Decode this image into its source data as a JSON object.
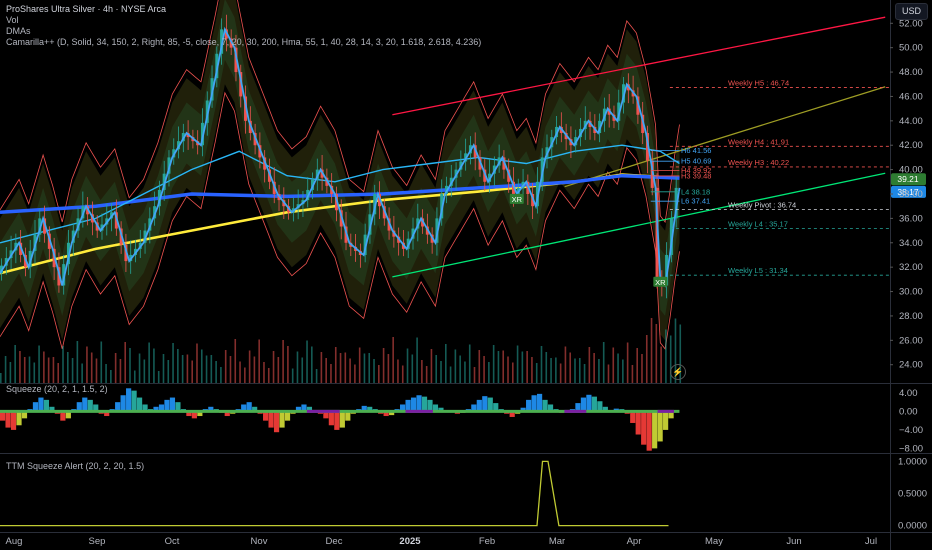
{
  "header": {
    "symbol_title": "ProShares Ultra Silver · 4h · NYSE Arca",
    "ind_vol": "Vol",
    "ind_dmas": "DMAs",
    "ind_camarilla": "Camarilla++ (D, Solid, 34, 150, 2, Right, 85, -5, close, 7, 20, 30, 200, Hma, 55, 1, 40, 28, 14, 3, 20, 1.618, 2.618, 4.236)",
    "currency_button": "USD"
  },
  "panes": {
    "squeeze_title": "Squeeze (20, 2, 1, 1.5, 2)",
    "ttm_title": "TTM Squeeze Alert (20, 2, 20, 1.5)"
  },
  "colors": {
    "background": "#000000",
    "candle_up": "#26a69a",
    "candle_down": "#ef5350",
    "dma_blue": "#2962ff",
    "dma_yellow": "#ffeb3b",
    "channel_red": "#ff1744",
    "channel_green": "#00e676",
    "hma_cyan": "#29b6f6"
  },
  "chart_data": [
    {
      "type": "line",
      "name": "price",
      "x_axis_labels": [
        "Aug",
        "Sep",
        "Oct",
        "Nov",
        "Dec",
        "2025",
        "Feb",
        "Mar",
        "Apr",
        "May",
        "Jun",
        "Jul"
      ],
      "y_ticks": [
        "52.00",
        "50.00",
        "48.00",
        "46.00",
        "44.00",
        "42.00",
        "40.00",
        "38.00",
        "36.00",
        "34.00",
        "32.00",
        "30.00",
        "28.00",
        "26.00",
        "24.00"
      ],
      "ylim": [
        22.5,
        53.5
      ],
      "price_path": [
        [
          0,
          31.5
        ],
        [
          4,
          34
        ],
        [
          6,
          32
        ],
        [
          9,
          36
        ],
        [
          11,
          33.5
        ],
        [
          13,
          30.5
        ],
        [
          15,
          34
        ],
        [
          18,
          37
        ],
        [
          21,
          35
        ],
        [
          24,
          36.5
        ],
        [
          27,
          32.5
        ],
        [
          30,
          34
        ],
        [
          33,
          37
        ],
        [
          36,
          41
        ],
        [
          39,
          43
        ],
        [
          42,
          42
        ],
        [
          45,
          47.5
        ],
        [
          47,
          51.5
        ],
        [
          49,
          50
        ],
        [
          52,
          44
        ],
        [
          55,
          41
        ],
        [
          58,
          38
        ],
        [
          61,
          36.5
        ],
        [
          64,
          37.5
        ],
        [
          67,
          40
        ],
        [
          70,
          38
        ],
        [
          73,
          34
        ],
        [
          76,
          33
        ],
        [
          79,
          38
        ],
        [
          82,
          35
        ],
        [
          85,
          33.5
        ],
        [
          88,
          36
        ],
        [
          91,
          34
        ],
        [
          93,
          38
        ],
        [
          96,
          40
        ],
        [
          99,
          42
        ],
        [
          102,
          39
        ],
        [
          105,
          41
        ],
        [
          108,
          38
        ],
        [
          110,
          39
        ],
        [
          112,
          37
        ],
        [
          114,
          41
        ],
        [
          117,
          43.5
        ],
        [
          120,
          42
        ],
        [
          123,
          44
        ],
        [
          125,
          43
        ],
        [
          127,
          45
        ],
        [
          129,
          44
        ],
        [
          131,
          47
        ],
        [
          133,
          46
        ],
        [
          135,
          43
        ],
        [
          137,
          38.5
        ],
        [
          138,
          31
        ],
        [
          139,
          30.5
        ],
        [
          140,
          33
        ],
        [
          141,
          36
        ],
        [
          142,
          38.5
        ]
      ],
      "dma_blue_path": [
        [
          0,
          36.5
        ],
        [
          20,
          37
        ],
        [
          40,
          38
        ],
        [
          60,
          37.8
        ],
        [
          80,
          38
        ],
        [
          100,
          38.5
        ],
        [
          120,
          39
        ],
        [
          130,
          39.5
        ],
        [
          142,
          39.3
        ]
      ],
      "dma_yellow_path": [
        [
          0,
          31.5
        ],
        [
          20,
          33.5
        ],
        [
          40,
          35
        ],
        [
          60,
          36.5
        ],
        [
          80,
          37.5
        ],
        [
          100,
          38.2
        ],
        [
          120,
          39
        ],
        [
          130,
          39.6
        ],
        [
          142,
          39.3
        ]
      ],
      "hma_path": [
        [
          0,
          34
        ],
        [
          10,
          35
        ],
        [
          20,
          36
        ],
        [
          30,
          38
        ],
        [
          40,
          40
        ],
        [
          50,
          41.5
        ],
        [
          60,
          39.5
        ],
        [
          70,
          39
        ],
        [
          80,
          40
        ],
        [
          90,
          40.5
        ],
        [
          100,
          41
        ],
        [
          110,
          40.5
        ],
        [
          120,
          41.5
        ],
        [
          130,
          42
        ],
        [
          138,
          41.5
        ],
        [
          142,
          40.5
        ]
      ],
      "channels": [
        {
          "name": "upper-red",
          "from": [
            82,
            44.5
          ],
          "to": [
            185,
            52.5
          ]
        },
        {
          "name": "lower-green",
          "from": [
            82,
            31.2
          ],
          "to": [
            185,
            39.7
          ]
        },
        {
          "name": "mid-olive",
          "from": [
            118,
            38.6
          ],
          "to": [
            185,
            46.8
          ]
        }
      ],
      "pivot_labels": [
        {
          "text": "Weekly H5 : 46.74",
          "y": 46.74,
          "color": "#ef5350"
        },
        {
          "text": "Weekly H4 : 41.91",
          "y": 41.91,
          "color": "#ef5350"
        },
        {
          "text": "Weekly H3 : 40.22",
          "y": 40.22,
          "color": "#ef5350"
        },
        {
          "text": "Weekly Pivot : 36.74",
          "y": 36.74,
          "color": "#d1d4dc"
        },
        {
          "text": "Weekly L4 : 35.17",
          "y": 35.17,
          "color": "#26a69a"
        },
        {
          "text": "Weekly L5 : 31.34",
          "y": 31.34,
          "color": "#26a69a"
        }
      ],
      "daily_labels": [
        {
          "text": "H6 41.56",
          "y": 41.56,
          "color": "#42a5f5"
        },
        {
          "text": "H5 40.69",
          "y": 40.69,
          "color": "#42a5f5"
        },
        {
          "text": "H4 39.92",
          "y": 39.92,
          "color": "#ef5350"
        },
        {
          "text": "H3 39.48",
          "y": 39.48,
          "color": "#ef5350"
        },
        {
          "text": "L4 38.18",
          "y": 38.18,
          "color": "#26a69a"
        },
        {
          "text": "L6 37.41",
          "y": 37.41,
          "color": "#42a5f5"
        }
      ],
      "price_badges": [
        {
          "text": "39.21",
          "y": 39.21,
          "bg": "#2e7d32"
        },
        {
          "text": "38.17",
          "y": 38.17,
          "bg": "#1e88e5"
        }
      ],
      "markers": [
        {
          "text": "XR",
          "x": 138,
          "y": 30.8,
          "bg": "#2e7d32"
        },
        {
          "text": "XR",
          "x": 108,
          "y": 37.6,
          "bg": "#2e7d32"
        }
      ]
    },
    {
      "type": "bar",
      "name": "Squeeze",
      "y_ticks": [
        "4.00",
        "0.00",
        "−4.00",
        "−8.00"
      ],
      "ylim": [
        -9,
        5.5
      ],
      "momentum": [
        -2,
        -3.5,
        -4,
        -3,
        -1.5,
        0.5,
        2,
        3,
        2.5,
        1,
        -0.5,
        -2,
        -1.5,
        0.5,
        2,
        3,
        2.5,
        1.5,
        -0.5,
        -1,
        0.5,
        2,
        3.5,
        5,
        4.5,
        3,
        1.5,
        0.5,
        1,
        1.5,
        2.5,
        3,
        2,
        0.5,
        -1,
        -1.5,
        -1,
        0.5,
        1,
        0.5,
        -0.3,
        -1,
        -0.5,
        0.5,
        1.5,
        2,
        1,
        -0.5,
        -2,
        -3.5,
        -4.5,
        -3.5,
        -2,
        -0.5,
        1,
        1.5,
        1,
        0.3,
        -0.5,
        -1.5,
        -3,
        -4,
        -3.5,
        -2,
        -0.5,
        0.5,
        1.2,
        1,
        0.5,
        -0.5,
        -1,
        -0.8,
        0.5,
        1.5,
        2.5,
        3,
        3.5,
        3.2,
        2.5,
        1.5,
        0.8,
        0.3,
        -0.2,
        -0.5,
        -0.3,
        0.5,
        1.5,
        2.5,
        3.3,
        3,
        1.8,
        0.5,
        -0.5,
        -1.2,
        -0.5,
        0.8,
        2.5,
        3.5,
        3.8,
        2.5,
        1.5,
        0.5,
        -0.3,
        -0.2,
        0.5,
        1.8,
        3,
        3.6,
        3.2,
        2.2,
        1,
        0.3,
        0.6,
        0.5,
        -0.5,
        -2.5,
        -5,
        -7.2,
        -8.5,
        -8,
        -6.5,
        -4,
        -1.5,
        0.3
      ]
    },
    {
      "type": "line",
      "name": "TTM Squeeze Alert",
      "y_ticks": [
        "1.0000",
        "0.5000",
        "0.0000"
      ],
      "ylim": [
        -0.1,
        1.1
      ],
      "x": [
        0,
        96,
        98,
        99,
        100,
        102,
        122
      ],
      "values": [
        0,
        0,
        0,
        1,
        1,
        0,
        0
      ]
    }
  ]
}
